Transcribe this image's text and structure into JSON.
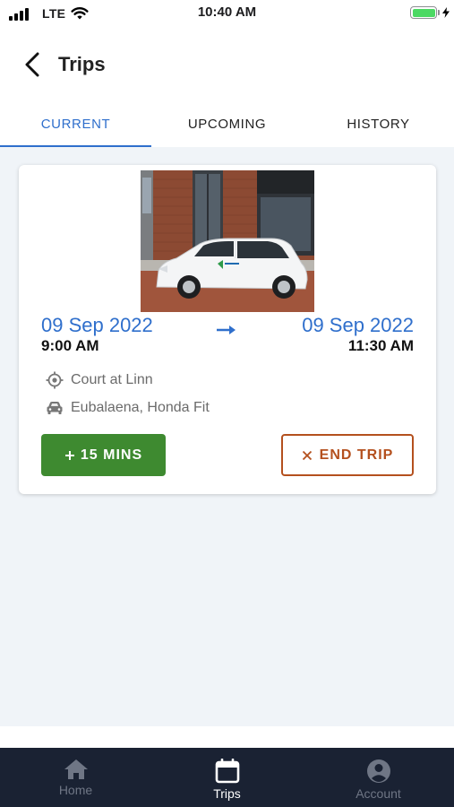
{
  "status_bar": {
    "carrier": "LTE",
    "time": "10:40 AM",
    "battery_level": 1.0
  },
  "header": {
    "title": "Trips",
    "back_icon": "chevron-left-icon"
  },
  "tabs": [
    {
      "label": "CURRENT",
      "active": true
    },
    {
      "label": "UPCOMING",
      "active": false
    },
    {
      "label": "HISTORY",
      "active": false
    }
  ],
  "trip": {
    "start_date": "09 Sep 2022",
    "start_time": "9:00 AM",
    "end_date": "09 Sep 2022",
    "end_time": "11:30 AM",
    "location": "Court at Linn",
    "location_icon": "location-target-icon",
    "vehicle": "Eubalaena, Honda Fit",
    "vehicle_icon": "car-icon",
    "extend_label": "15 MINS",
    "end_label": "END TRIP"
  },
  "nav": [
    {
      "label": "Home",
      "icon": "home-icon",
      "active": false
    },
    {
      "label": "Trips",
      "icon": "calendar-icon",
      "active": true
    },
    {
      "label": "Account",
      "icon": "account-circle-icon",
      "active": false
    }
  ],
  "colors": {
    "accent": "#2f6fcc",
    "extend_button": "#3e8a30",
    "end_button": "#b4501e",
    "tab_bar": "#1a2233",
    "background": "#f0f4f8"
  }
}
